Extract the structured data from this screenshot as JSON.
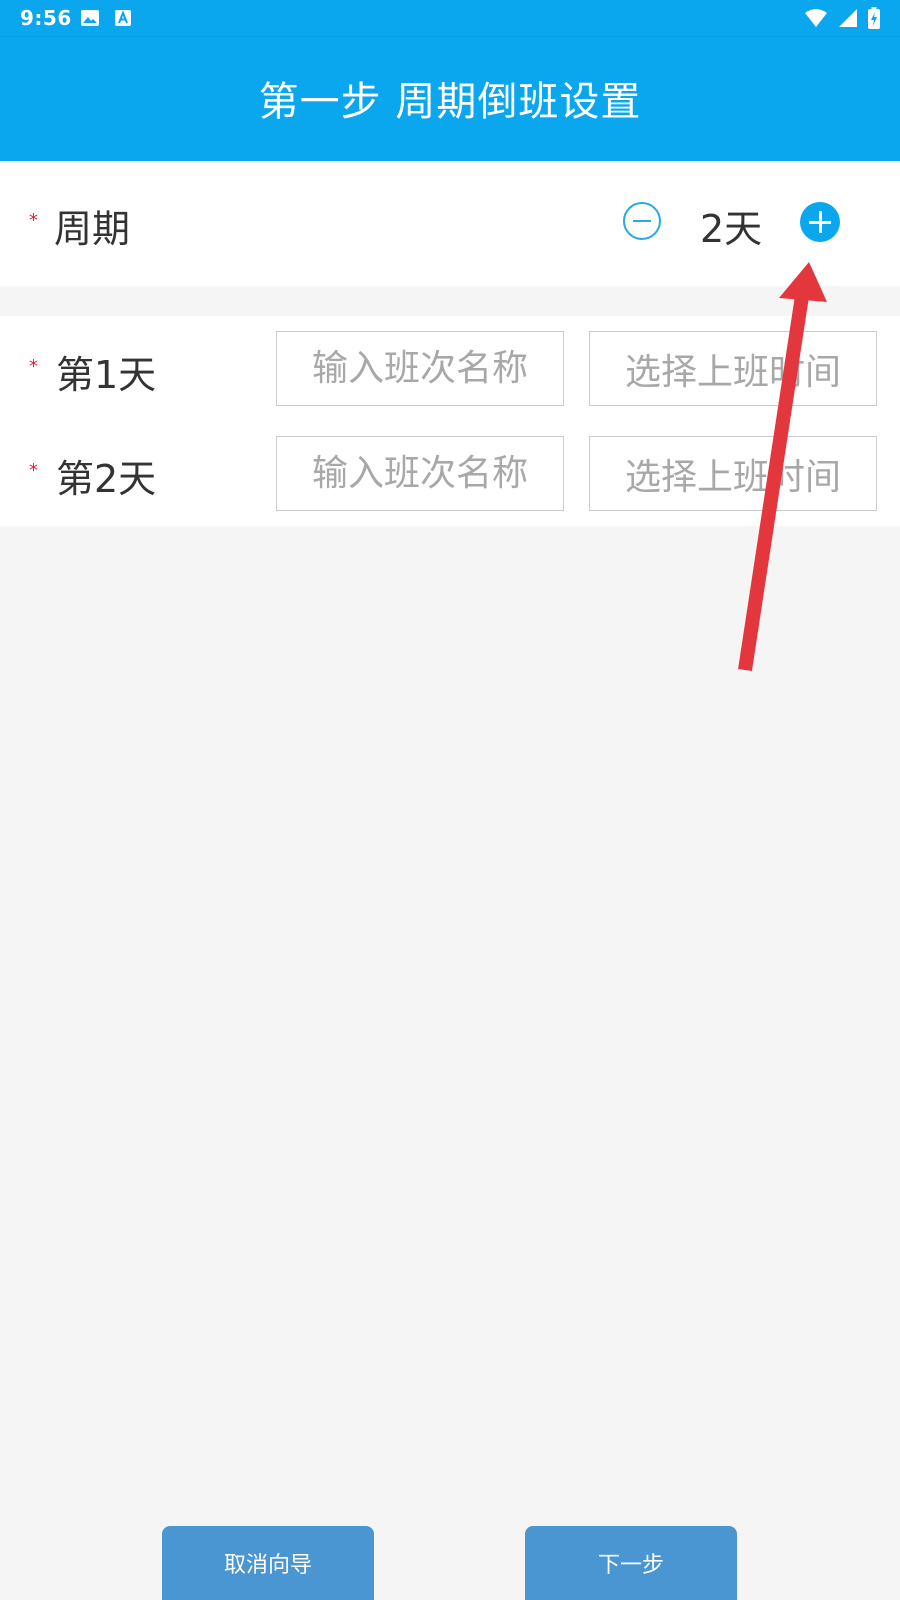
{
  "status_bar": {
    "time": "9:56"
  },
  "header": {
    "title": "第一步 周期倒班设置"
  },
  "cycle": {
    "label": "周期",
    "value": "2天",
    "required_mark": "*"
  },
  "days": [
    {
      "label": "第1天",
      "name_placeholder": "输入班次名称",
      "time_placeholder": "选择上班时间"
    },
    {
      "label": "第2天",
      "name_placeholder": "输入班次名称",
      "time_placeholder": "选择上班时间"
    }
  ],
  "footer": {
    "cancel_label": "取消向导",
    "next_label": "下一步"
  },
  "colors": {
    "primary": "#0aa6ee",
    "button": "#4a96d2",
    "required": "#e3242b",
    "annotation_arrow": "#e3363d"
  }
}
